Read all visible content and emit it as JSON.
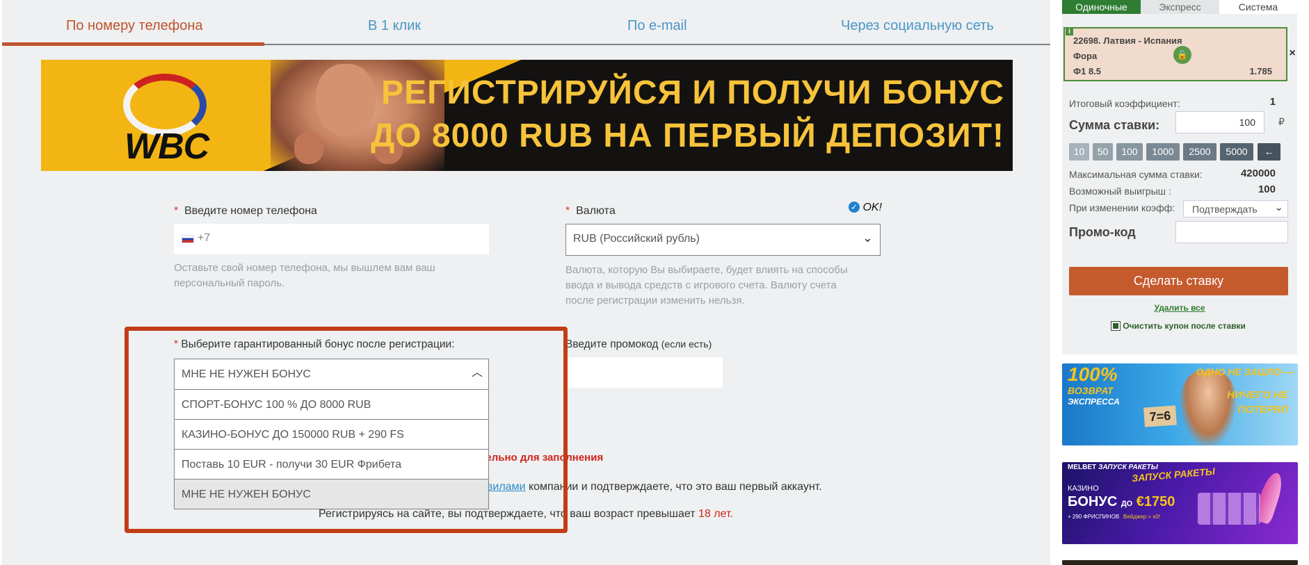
{
  "tabs": [
    {
      "label": "По номеру телефона",
      "active": true
    },
    {
      "label": "В 1 клик",
      "active": false
    },
    {
      "label": "По e-mail",
      "active": false
    },
    {
      "label": "Через социальную сеть",
      "active": false
    }
  ],
  "banner": {
    "logo_text": "WBC",
    "line1": "РЕГИСТРИРУЙСЯ И ПОЛУЧИ БОНУС",
    "line2": "ДО 8000 RUB НА ПЕРВЫЙ ДЕПОЗИТ!"
  },
  "form": {
    "required_mark": "*",
    "phone": {
      "label": "Введите номер телефона",
      "prefix": "+7",
      "hint_line1": "Оставьте свой номер телефона, мы вышлем вам ваш",
      "hint_line2": "персональный пароль."
    },
    "currency": {
      "label": "Валюта",
      "ok_text": "OK!",
      "value": "RUB (Российский рубль)",
      "hint_line1": "Валюта, которую Вы выбираете, будет влиять на способы",
      "hint_line2": "ввода и вывода средств с игрового счета. Валюту счета",
      "hint_line3": "после регистрации изменить нельзя."
    },
    "bonus": {
      "label": "Выберите гарантированный бонус после регистрации:",
      "selected": "МНЕ НЕ НУЖЕН БОНУС",
      "options": [
        "СПОРТ-БОНУС 100 % ДО 8000 RUB",
        "КАЗИНО-БОНУС ДО 150000 RUB + 290 FS",
        "Поставь 10 EUR - получи 30 EUR Фрибета",
        "МНЕ НЕ НУЖЕН БОНУС"
      ]
    },
    "promocode": {
      "label": "Введите промокод",
      "label_suffix": "(если есть)"
    },
    "required_note": "тельно для заполнения",
    "rules_link": "авилами",
    "rules_text": "компании и подтверждаете, что это ваш первый аккаунт.",
    "age_text": "Регистрируясь на сайте, вы подтверждаете, что ваш возраст превышает",
    "age_value": "18 лет."
  },
  "sidebar": {
    "bet_tabs": [
      "Одиночные",
      "Экспресс",
      "Система"
    ],
    "coupon": {
      "info_icon_label": "i",
      "event": "22698. Латвия - Испания",
      "market": "Фора",
      "selection": "Ф1 8.5",
      "odds": "1.785",
      "close_label": "×"
    },
    "total_coef_label": "Итоговый коэффициент:",
    "total_coef_value": "1",
    "stake_label": "Сумма ставки:",
    "stake_value": "100",
    "currency_symbol": "₽",
    "quick_amounts": [
      "10",
      "50",
      "100",
      "1000",
      "2500",
      "5000"
    ],
    "backspace_label": "←",
    "max_stake_label": "Максимальная сумма ставки:",
    "max_stake_value": "420000",
    "possible_win_label": "Возможный выигрыш :",
    "possible_win_value": "100",
    "odds_change_label": "При изменении коэфф:",
    "odds_change_value": "Подтверждать",
    "promo_label": "Промо-код",
    "place_bet_label": "Сделать ставку",
    "delete_all_label": "Удалить все",
    "clear_coupon_label": "Очистить купон после ставки",
    "promo1": {
      "big": "100%",
      "line1": "ВОЗВРАТ",
      "line2": "ЭКСПРЕССА",
      "text1": "ОДНО НЕ ЗАШЛО —",
      "text2": "НИЧЕГО НЕ",
      "text3": "ПОТЕРЯЛ",
      "badge": "7=6"
    },
    "promo2": {
      "brand": "MELBET",
      "tag": "ЗАПУСК РАКЕТЫ",
      "title": "ЗАПУСК РАКЕТЫ",
      "casino": "КАЗИНО",
      "bonus": "БОНУС",
      "upto": "ДО",
      "amount": "€1750",
      "fs": "+ 290 ФРИСПИНОВ",
      "wager": "Вейджер = х0!"
    }
  },
  "colors": {
    "accent": "#c0532b",
    "link": "#4a96c5",
    "green": "#2e7d32",
    "highlight_box": "#c13d16"
  }
}
